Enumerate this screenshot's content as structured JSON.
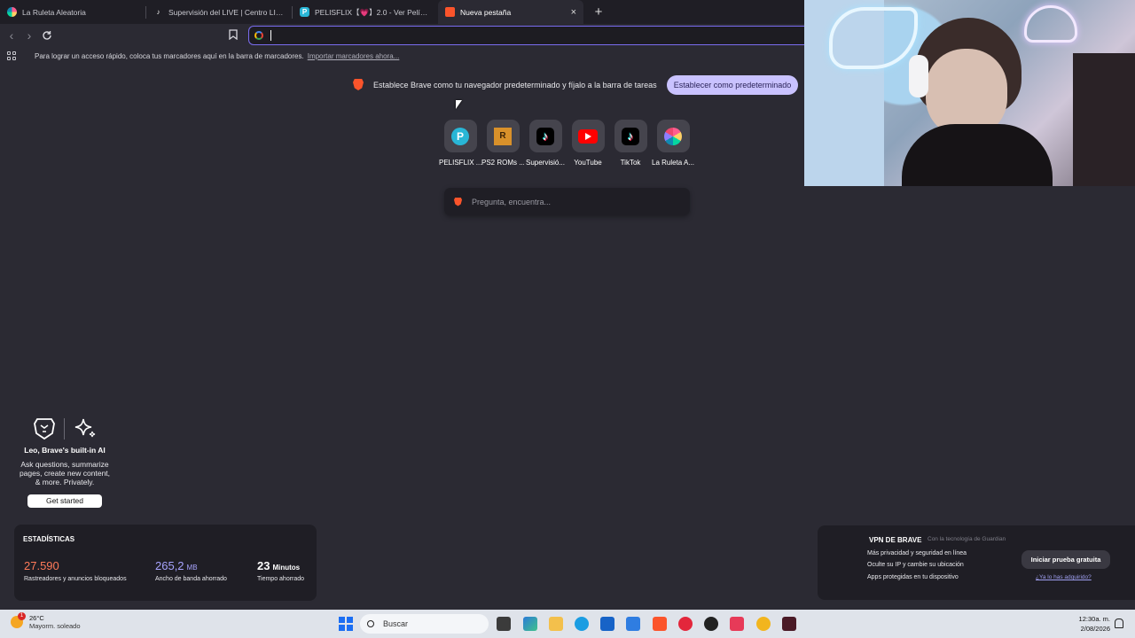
{
  "tabs": [
    {
      "label": "La Ruleta Aleatoria",
      "icon": "wheel-icon"
    },
    {
      "label": "Supervisión del LIVE | Centro LIVE de",
      "icon": "tiktok-icon"
    },
    {
      "label": "PELISFLIX【💗】2.0 - Ver Películas Gr",
      "icon": "pelisflix-icon"
    },
    {
      "label": "Nueva pestaña",
      "icon": "brave-icon",
      "active": true
    }
  ],
  "new_tab_symbol": "+",
  "close_symbol": "×",
  "bookmarks_bar": {
    "message": "Para lograr un acceso rápido, coloca tus marcadores aquí en la barra de marcadores.",
    "import_link": "Importar marcadores ahora..."
  },
  "default_banner": {
    "text": "Establece Brave como tu navegador predeterminado y fíjalo a la barra de tareas",
    "button": "Establecer como predeterminado"
  },
  "top_sites": [
    {
      "label": "PELISFLIX ...",
      "icon": "pelisflix-icon",
      "glyph": "P"
    },
    {
      "label": "PS2 ROMs ...",
      "icon": "ps2roms-icon",
      "glyph": "R"
    },
    {
      "label": "Supervisió...",
      "icon": "tiktok-icon",
      "glyph": "♪"
    },
    {
      "label": "YouTube",
      "icon": "youtube-icon",
      "glyph": ""
    },
    {
      "label": "TikTok",
      "icon": "tiktok-icon",
      "glyph": "♪"
    },
    {
      "label": "La Ruleta A...",
      "icon": "wheel-icon",
      "glyph": ""
    }
  ],
  "search": {
    "placeholder": "Pregunta, encuentra..."
  },
  "leo": {
    "title": "Leo, Brave's built-in AI",
    "description": "Ask questions, summarize pages, create new content, & more. Privately.",
    "button": "Get started"
  },
  "stats": {
    "heading": "ESTADÍSTICAS",
    "items": [
      {
        "value": "27.590",
        "unit": "",
        "label": "Rastreadores y anuncios bloqueados",
        "color": "#ff7a59"
      },
      {
        "value": "265,2",
        "unit": "MB",
        "label": "Ancho de banda ahorrado",
        "color": "#a8a4ff"
      },
      {
        "value": "23",
        "unit": "Minutos",
        "label": "Tiempo ahorrado",
        "color": "#ffffff"
      }
    ]
  },
  "vpn": {
    "title": "VPN DE BRAVE",
    "subtitle": "Con la tecnología de Guardian",
    "features": [
      "Más privacidad y seguridad en línea",
      "Oculte su IP y cambie su ubicación",
      "Apps protegidas en tu dispositivo"
    ],
    "button": "Iniciar prueba gratuita",
    "link": "¿Ya lo has adquirido?"
  },
  "taskbar": {
    "weather_temp": "26°C",
    "weather_desc": "Mayorm. soleado",
    "weather_badge": "1",
    "search_label": "Buscar",
    "time": "12:30a. m.",
    "date": "2/08/2026"
  },
  "colors": {
    "accent": "#7a6cf0",
    "brave_orange": "#fb542b",
    "banner_button": "#c9c2ff"
  }
}
